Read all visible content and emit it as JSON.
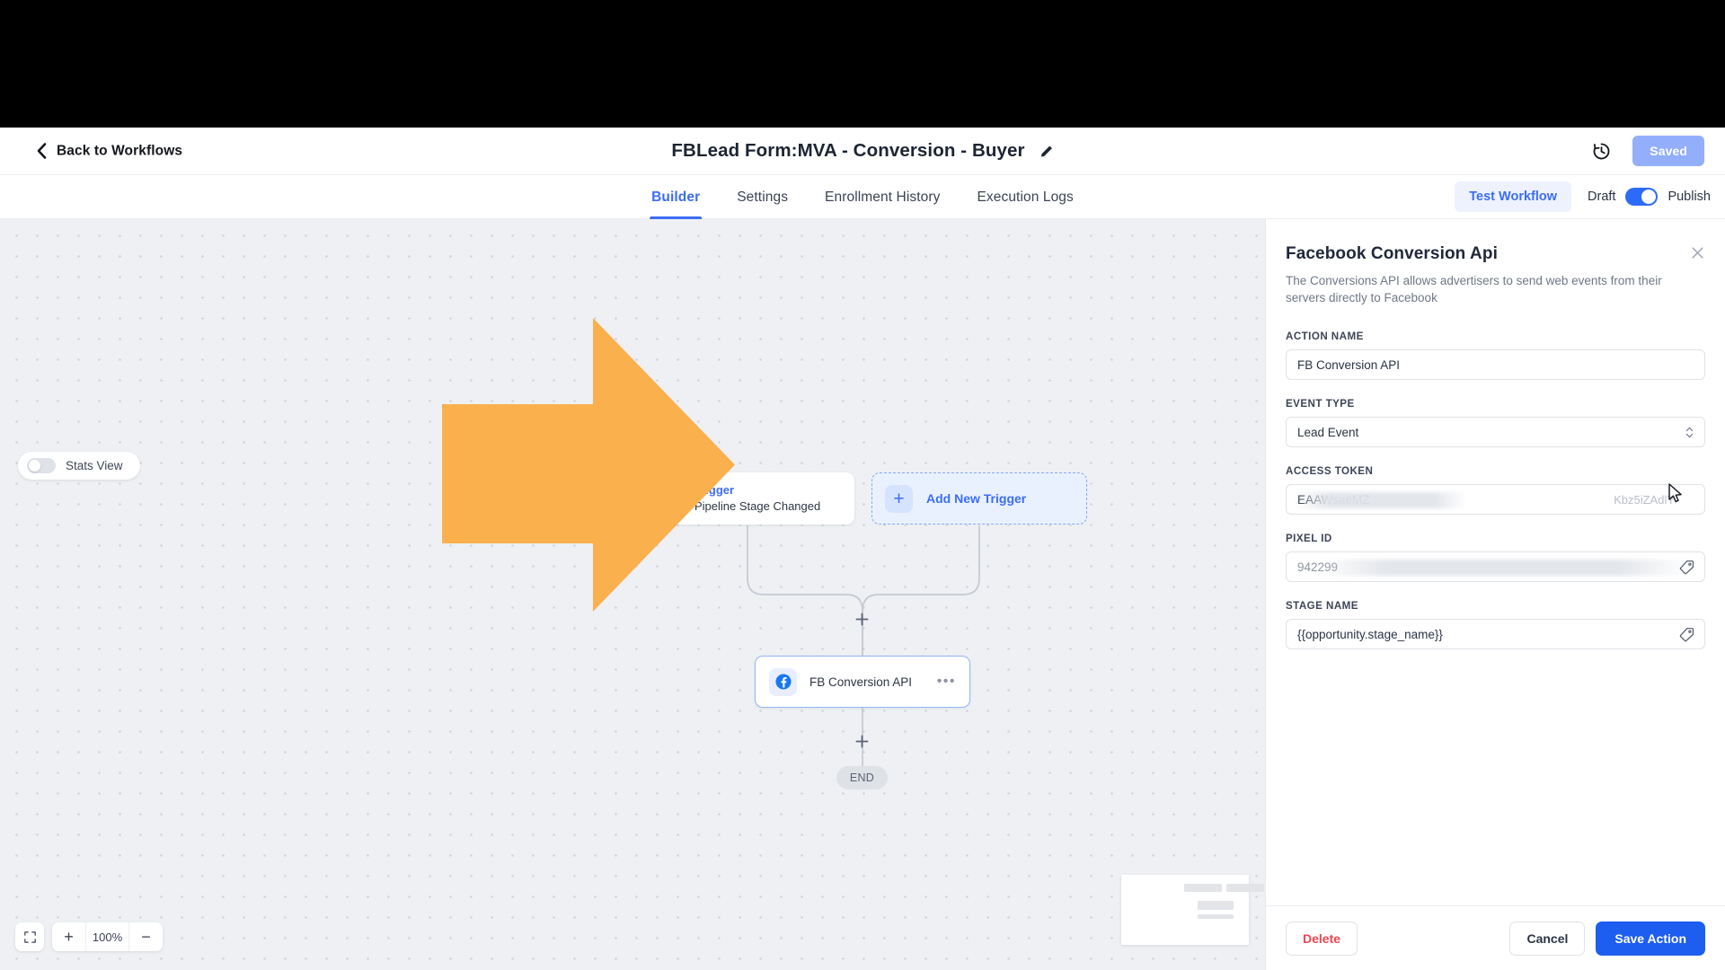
{
  "topbar": {
    "back_label": "Back to Workflows",
    "back_icon": "chevron-left-icon",
    "workflow_title": "FBLead Form:MVA - Conversion - Buyer",
    "edit_icon": "pencil-icon",
    "history_icon": "clock-history-icon",
    "saved_label": "Saved"
  },
  "tabs": {
    "items": [
      {
        "label": "Builder",
        "active": true
      },
      {
        "label": "Settings",
        "active": false
      },
      {
        "label": "Enrollment History",
        "active": false
      },
      {
        "label": "Execution Logs",
        "active": false
      }
    ],
    "test_workflow_label": "Test Workflow",
    "draft_label": "Draft",
    "publish_label": "Publish",
    "toggle_state": "on"
  },
  "canvas": {
    "stats_view_label": "Stats View",
    "stats_view_state": "off",
    "trigger_node": {
      "icon": "refresh-cycle-icon",
      "title": "Trigger",
      "subtitle": "Pipeline Stage Changed"
    },
    "add_trigger_node": {
      "icon": "plus-icon",
      "label": "Add New Trigger"
    },
    "action_node": {
      "icon": "facebook-icon",
      "label": "FB Conversion API",
      "menu_icon": "ellipsis-icon"
    },
    "end_node_label": "END",
    "add_step_icon": "plus-icon",
    "zoom": {
      "fit_icon": "fit-screen-icon",
      "zoom_in_label": "+",
      "zoom_level": "100%",
      "zoom_out_label": "−"
    },
    "minimap_label": "minimap"
  },
  "panel": {
    "title": "Facebook Conversion Api",
    "description": "The Conversions API allows advertisers to send web events from their servers directly to Facebook",
    "close_icon": "close-icon",
    "fields": [
      {
        "label": "ACTION NAME",
        "value": "FB Conversion API",
        "type": "text",
        "icon": null
      },
      {
        "label": "EVENT TYPE",
        "value": "Lead Event",
        "type": "select",
        "icon": "stepper-icon"
      },
      {
        "label": "ACCESS TOKEN",
        "value": "EAAWsaeMZ",
        "value_tail": "Kbz5iZAdlY",
        "type": "password-masked",
        "icon": null
      },
      {
        "label": "PIXEL ID",
        "value": "942299",
        "type": "text-redacted",
        "icon": "tag-icon"
      },
      {
        "label": "STAGE NAME",
        "value": "{{opportunity.stage_name}}",
        "type": "text",
        "icon": "tag-icon"
      }
    ],
    "footer": {
      "delete_label": "Delete",
      "cancel_label": "Cancel",
      "save_label": "Save Action"
    }
  },
  "overlay": {
    "annotation_arrow": "right-pointing-arrow",
    "arrow_color": "#fbb04e"
  },
  "colors": {
    "accent_blue": "#3b6df6",
    "primary_button": "#1d5ef0",
    "saved_button": "#93aefb",
    "delete_red": "#ef4450",
    "canvas_bg": "#eef0f3",
    "arrow_orange": "#fbb04e"
  }
}
